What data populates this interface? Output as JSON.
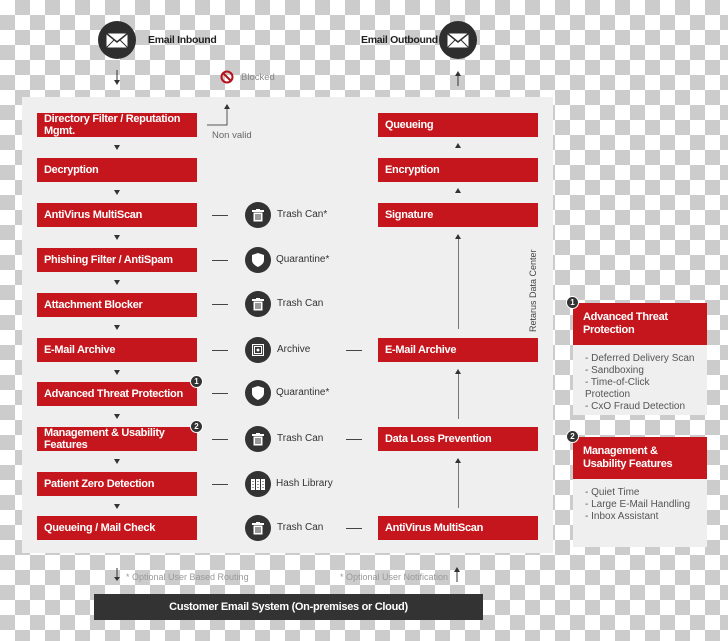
{
  "header": {
    "inbound_label": "Email Inbound",
    "outbound_label": "Email Outbound",
    "blocked_label": "Blocked",
    "non_valid_label": "Non valid"
  },
  "inbound_steps": [
    {
      "label": "Directory Filter / Reputation Mgmt."
    },
    {
      "label": "Decryption"
    },
    {
      "label": "AntiVirus MultiScan"
    },
    {
      "label": "Phishing Filter / AntiSpam"
    },
    {
      "label": "Attachment Blocker"
    },
    {
      "label": "E-Mail Archive"
    },
    {
      "label": "Advanced Threat Protection",
      "badge": "1"
    },
    {
      "label": "Management & Usability Features",
      "badge": "2"
    },
    {
      "label": "Patient Zero Detection"
    },
    {
      "label": "Queueing / Mail Check"
    }
  ],
  "actions": [
    {
      "icon": "trash-can-icon",
      "label": "Trash Can*"
    },
    {
      "icon": "shield-icon",
      "label": "Quarantine*"
    },
    {
      "icon": "trash-can-icon",
      "label": "Trash Can"
    },
    {
      "icon": "archive-safe-icon",
      "label": "Archive"
    },
    {
      "icon": "shield-icon",
      "label": "Quarantine*"
    },
    {
      "icon": "trash-can-icon",
      "label": "Trash Can"
    },
    {
      "icon": "hash-library-icon",
      "label": "Hash Library"
    },
    {
      "icon": "trash-can-icon",
      "label": "Trash Can"
    }
  ],
  "outbound_steps": [
    {
      "label": "Queueing"
    },
    {
      "label": "Encryption"
    },
    {
      "label": "Signature"
    },
    {
      "label": "E-Mail Archive"
    },
    {
      "label": "Data Loss Prevention"
    },
    {
      "label": "AntiVirus MultiScan"
    }
  ],
  "data_center_label": "Retarus Data Center",
  "cards": [
    {
      "badge": "1",
      "title_line1": "Advanced Threat",
      "title_line2": "Protection",
      "items": [
        "- Deferred Delivery Scan",
        "- Sandboxing",
        "- Time-of-Click Protection",
        "- CxO Fraud Detection"
      ]
    },
    {
      "badge": "2",
      "title_line1": "Management &",
      "title_line2": "Usability Features",
      "items": [
        "- Quiet Time",
        "- Large E-Mail Handling",
        "- Inbox Assistant"
      ]
    }
  ],
  "footer": {
    "routing_note": "* Optional User Based Routing",
    "notification_note": "* Optional User Notification",
    "customer_system": "Customer Email System (On-premises or Cloud)"
  },
  "colors": {
    "accent_red": "#c4161c",
    "dark": "#333333",
    "panel_bg": "#efefef"
  }
}
